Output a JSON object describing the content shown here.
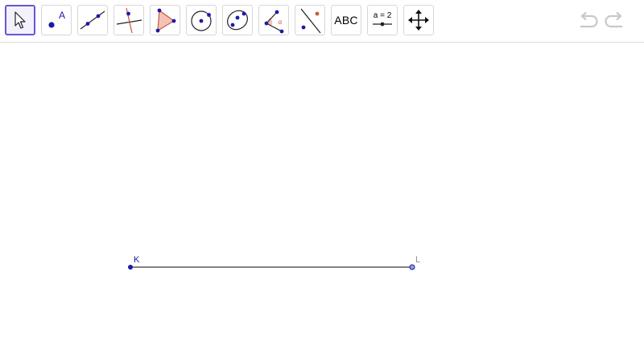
{
  "toolbar": {
    "tools": [
      {
        "name": "move-tool",
        "label": ""
      },
      {
        "name": "point-tool",
        "label": "A"
      },
      {
        "name": "line-tool",
        "label": ""
      },
      {
        "name": "perpendicular-line-tool",
        "label": ""
      },
      {
        "name": "polygon-tool",
        "label": ""
      },
      {
        "name": "circle-center-point-tool",
        "label": ""
      },
      {
        "name": "conic-ellipse-tool",
        "label": ""
      },
      {
        "name": "angle-tool",
        "label": "α"
      },
      {
        "name": "reflect-tool",
        "label": ""
      },
      {
        "name": "text-tool",
        "label": "ABC"
      },
      {
        "name": "slider-tool",
        "label": "a = 2"
      },
      {
        "name": "move-graphics-view-tool",
        "label": ""
      }
    ],
    "selected_tool": "move-tool",
    "undo_icon": "undo-icon",
    "redo_icon": "redo-icon"
  },
  "canvas": {
    "segment": {
      "name": "segment-KL"
    },
    "points": [
      {
        "label": "K",
        "color": "#1a1aa8"
      },
      {
        "label": "L",
        "color": "#8d8d8d"
      }
    ]
  },
  "colors": {
    "accent": "#6557d2",
    "point": "#1a1aa8",
    "polygon_fill": "#f4c1b4",
    "polygon_stroke": "#c45a3e"
  }
}
